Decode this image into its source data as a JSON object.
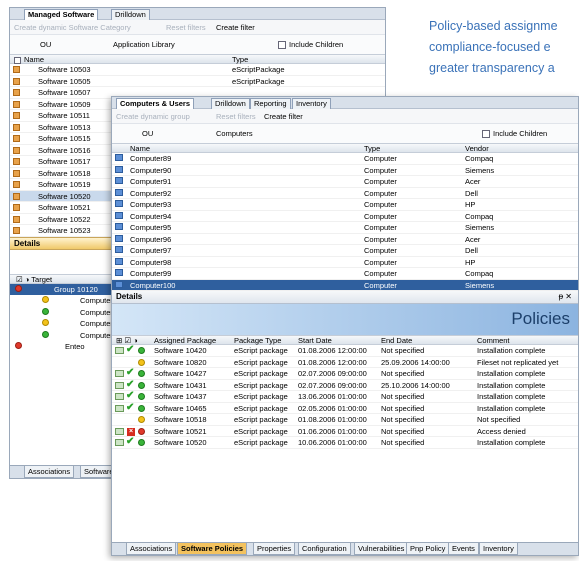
{
  "tagline": [
    "Policy-based assignme",
    "compliance-focused e",
    "greater transparency a"
  ],
  "back": {
    "tabs": [
      "Managed Software",
      "Drilldown"
    ],
    "toolbar": {
      "create": "Create dynamic Software Category",
      "reset": "Reset filters",
      "filter": "Create filter"
    },
    "filter": {
      "ou": "OU",
      "library": "Application Library",
      "include": "Include Children"
    },
    "columns": {
      "name": "Name",
      "type": "Type"
    },
    "rows": [
      "Software 10503",
      "Software 10505",
      "Software 10507",
      "Software 10509",
      "Software 10511",
      "Software 10513",
      "Software 10515",
      "Software 10516",
      "Software 10517",
      "Software 10518",
      "Software 10519",
      "Software 10520",
      "Software 10521",
      "Software 10522",
      "Software 10523"
    ],
    "type_values": [
      "eScriptPackage",
      "eScriptPackage"
    ],
    "details": "Details",
    "target_header": "Target",
    "tree": {
      "group": "Group 10120",
      "items": [
        "Computer",
        "Computer",
        "Computer",
        "Computer"
      ],
      "enteo": "Enteo"
    },
    "bottom_tabs": [
      "Associations",
      "Software"
    ]
  },
  "front": {
    "tabs": [
      "Computers & Users",
      "Drilldown",
      "Reporting",
      "Inventory"
    ],
    "toolbar": {
      "create": "Create dynamic group",
      "reset": "Reset filters",
      "filter": "Create filter"
    },
    "filter": {
      "ou": "OU",
      "computers": "Computers",
      "include": "Include Children"
    },
    "columns": {
      "name": "Name",
      "type": "Type",
      "vendor": "Vendor"
    },
    "rows": [
      {
        "name": "Computer89",
        "type": "Computer",
        "vendor": "Compaq"
      },
      {
        "name": "Computer90",
        "type": "Computer",
        "vendor": "Siemens"
      },
      {
        "name": "Computer91",
        "type": "Computer",
        "vendor": "Acer"
      },
      {
        "name": "Computer92",
        "type": "Computer",
        "vendor": "Dell"
      },
      {
        "name": "Computer93",
        "type": "Computer",
        "vendor": "HP"
      },
      {
        "name": "Computer94",
        "type": "Computer",
        "vendor": "Compaq"
      },
      {
        "name": "Computer95",
        "type": "Computer",
        "vendor": "Siemens"
      },
      {
        "name": "Computer96",
        "type": "Computer",
        "vendor": "Acer"
      },
      {
        "name": "Computer97",
        "type": "Computer",
        "vendor": "Dell"
      },
      {
        "name": "Computer98",
        "type": "Computer",
        "vendor": "HP"
      },
      {
        "name": "Computer99",
        "type": "Computer",
        "vendor": "Compaq"
      },
      {
        "name": "Computer100",
        "type": "Computer",
        "vendor": "Siemens"
      }
    ],
    "details": "Details",
    "pin": "X",
    "banner": "Policies",
    "policy_columns": {
      "pkg": "Assigned Package",
      "ptype": "Package Type",
      "start": "Start Date",
      "end": "End Date",
      "comment": "Comment"
    },
    "policies": [
      {
        "pkg": "Software 10420",
        "ptype": "eScript package",
        "start": "01.08.2006 12:00:00",
        "end": "Not specified",
        "comment": "Installation complete",
        "icons": "env-check-green"
      },
      {
        "pkg": "Software 10820",
        "ptype": "eScript package",
        "start": "01.08.2006 12:00:00",
        "end": "25.09.2006 14:00:00",
        "comment": "Fileset not replicated yet",
        "icons": "yellow"
      },
      {
        "pkg": "Software 10427",
        "ptype": "eScript package",
        "start": "02.07.2006 09:00:00",
        "end": "Not specified",
        "comment": "Installation complete",
        "icons": "env-check-green"
      },
      {
        "pkg": "Software 10431",
        "ptype": "eScript package",
        "start": "02.07.2006 09:00:00",
        "end": "25.10.2006 14:00:00",
        "comment": "Installation complete",
        "icons": "env-check-green"
      },
      {
        "pkg": "Software 10437",
        "ptype": "eScript package",
        "start": "13.06.2006 01:00:00",
        "end": "Not specified",
        "comment": "Installation complete",
        "icons": "env-check-green"
      },
      {
        "pkg": "Software 10465",
        "ptype": "eScript package",
        "start": "02.05.2006 01:00:00",
        "end": "Not specified",
        "comment": "Installation complete",
        "icons": "env-check-green"
      },
      {
        "pkg": "Software 10518",
        "ptype": "eScript package",
        "start": "01.08.2006 01:00:00",
        "end": "Not specified",
        "comment": "Not specified",
        "icons": "yellow"
      },
      {
        "pkg": "Software 10521",
        "ptype": "eScript package",
        "start": "01.06.2006 01:00:00",
        "end": "Not specified",
        "comment": "Access denied",
        "icons": "env-x-red"
      },
      {
        "pkg": "Software 10520",
        "ptype": "eScript package",
        "start": "10.06.2006 01:00:00",
        "end": "Not specified",
        "comment": "Installation complete",
        "icons": "env-check-green"
      }
    ],
    "bottom_tabs": [
      "Associations",
      "Software Policies",
      "Properties",
      "Configuration",
      "Vulnerabilities",
      "Pnp Policy",
      "Events",
      "Inventory"
    ]
  }
}
